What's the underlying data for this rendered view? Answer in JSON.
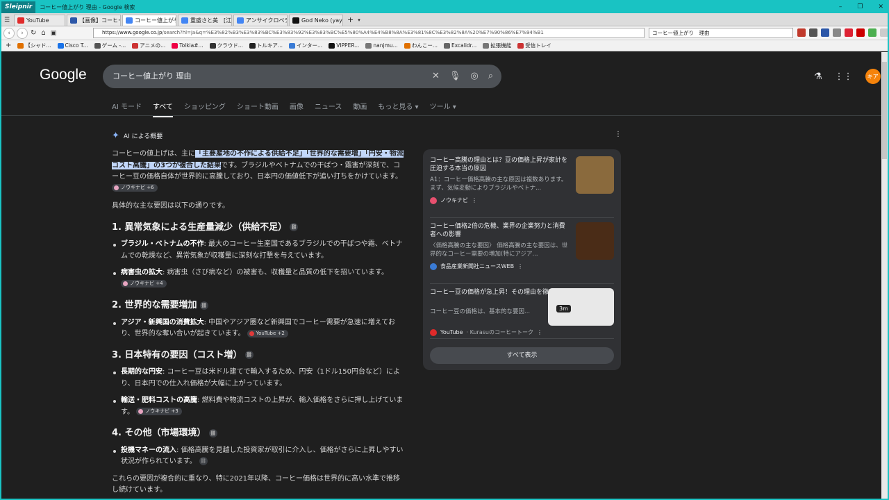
{
  "window": {
    "brand": "Sleipnir",
    "title": "コーヒー値上がり 理由 - Google 検索"
  },
  "tabs": [
    {
      "label": "YouTube",
      "color": "#e02a2a"
    },
    {
      "label": "【画像】コーヒーの...",
      "color": "#2c57a8"
    },
    {
      "label": "コーヒー値上がり...",
      "color": "#4285f4"
    },
    {
      "label": "重盛さと美　[江...",
      "color": "#4285f4"
    },
    {
      "label": "アンサイクロペディ...",
      "color": "#4285f4"
    },
    {
      "label": "God Neko (yaye...",
      "color": "#111111"
    }
  ],
  "nav": {
    "url_host": "https://www.google.co.jp",
    "url_path": "/search?hl=ja&q=%E3%82%B3%E3%83%BC%E3%83%92%E3%83%BC%E5%80%A4%E4%B8%8A%E3%81%8C%E3%82%8A%20%E7%90%86%E7%94%B1",
    "search_text": "コーヒー値上がり　理由"
  },
  "bookmarks": [
    "【シャド...",
    "Cisco T...",
    "ゲーム -...",
    "アニメの...",
    "Tolkia#...",
    "クラウド...",
    "トルキア...",
    "インター...",
    "VIPPER...",
    "nanjmu...",
    "わんこー...",
    "Excalidr...",
    "拡張機能",
    "受信トレイ"
  ],
  "google": {
    "logo": "Google",
    "query": "コーヒー値上がり 理由",
    "avatar": "キア",
    "tabs": [
      "AI モード",
      "すべて",
      "ショッピング",
      "ショート動画",
      "画像",
      "ニュース",
      "動画",
      "もっと見る ▾",
      "ツール ▾"
    ]
  },
  "ai": {
    "heading": "AI による概要",
    "intro_pre": "コーヒーの値上げは、主に",
    "intro_hl": "「主要産地の不作による供給不足」「世界的な需要増」「円安・物流コスト高騰」の3つが複合した結果",
    "intro_post": "です。ブラジルやベトナムでの干ばつ・霜害が深刻で、コーヒー豆の価格自体が世界的に高騰しており、日本円の価値低下が追い打ちをかけています。",
    "intro_chip": "ノウキナビ +6",
    "lead": "具体的な主な要因は以下の通りです。",
    "sections": [
      {
        "title": "1. 異常気象による生産量減少（供給不足）",
        "items": [
          {
            "b": "ブラジル・ベトナムの不作",
            "t": ": 最大のコーヒー生産国であるブラジルでの干ばつや霜、ベトナムでの乾燥など、異常気象が収穫量に深刻な打撃を与えています。",
            "chip": ""
          },
          {
            "b": "病害虫の拡大",
            "t": ": 病害虫（さび病など）の被害も、収穫量と品質の低下を招いています。",
            "chip": "ノウキナビ +4"
          }
        ]
      },
      {
        "title": "2. 世界的な需要増加",
        "items": [
          {
            "b": "アジア・新興国の消費拡大",
            "t": ": 中国やアジア圏など新興国でコーヒー需要が急速に増えており、世界的な奪い合いが起きています。",
            "chip": "YouTube +2"
          }
        ]
      },
      {
        "title": "3. 日本特有の要因（コスト増）",
        "items": [
          {
            "b": "長期的な円安",
            "t": ": コーヒー豆は米ドル建てで輸入するため、円安（1ドル150円台など）により、日本円での仕入れ価格が大幅に上がっています。",
            "chip": ""
          },
          {
            "b": "輸送・肥料コストの高騰",
            "t": ": 燃料費や物流コストの上昇が、輸入価格をさらに押し上げています。",
            "chip": "ノウキナビ +3"
          }
        ]
      },
      {
        "title": "4. その他（市場環境）",
        "items": [
          {
            "b": "投機マネーの流入",
            "t": ": 価格高騰を見越した投資家が取引に介入し、価格がさらに上昇しやすい状況が作られています。",
            "chip": ""
          }
        ]
      }
    ],
    "closing": "これらの要因が複合的に重なり、特に2021年以降、コーヒー価格は世界的に高い水準で推移し続けています。"
  },
  "sources": [
    {
      "title": "コーヒー高騰の理由とは？豆の価格上昇が家計を圧迫する本当の原因",
      "desc": "A1：コーヒー価格高騰の主な原因は複数あります。まず、気候変動によりブラジルやベトナ...",
      "site": "ノウキナビ",
      "dot": "#e8506f",
      "img": "#8a6a3d"
    },
    {
      "title": "コーヒー価格2倍の危機、業界の企業努力と消費者への影響",
      "desc": "〈価格高騰の主な要因〉 価格高騰の主な要因は、世界的なコーヒー需要の増加(特にアジア...",
      "site": "食品産業新聞社ニュースWEB",
      "dot": "#3a7bd5",
      "img": "#4a2c17"
    },
    {
      "title": "コーヒー豆の価格が急上昇！その理由を徹底解説",
      "desc": "コーヒー豆の価格は、基本的な要因...",
      "site": "YouTube",
      "site2": "· Kurasuのコーヒートーク",
      "dot": "#e02a2a",
      "img": "#e8e8e8",
      "duration": "3m"
    }
  ],
  "show_all": "すべて表示"
}
